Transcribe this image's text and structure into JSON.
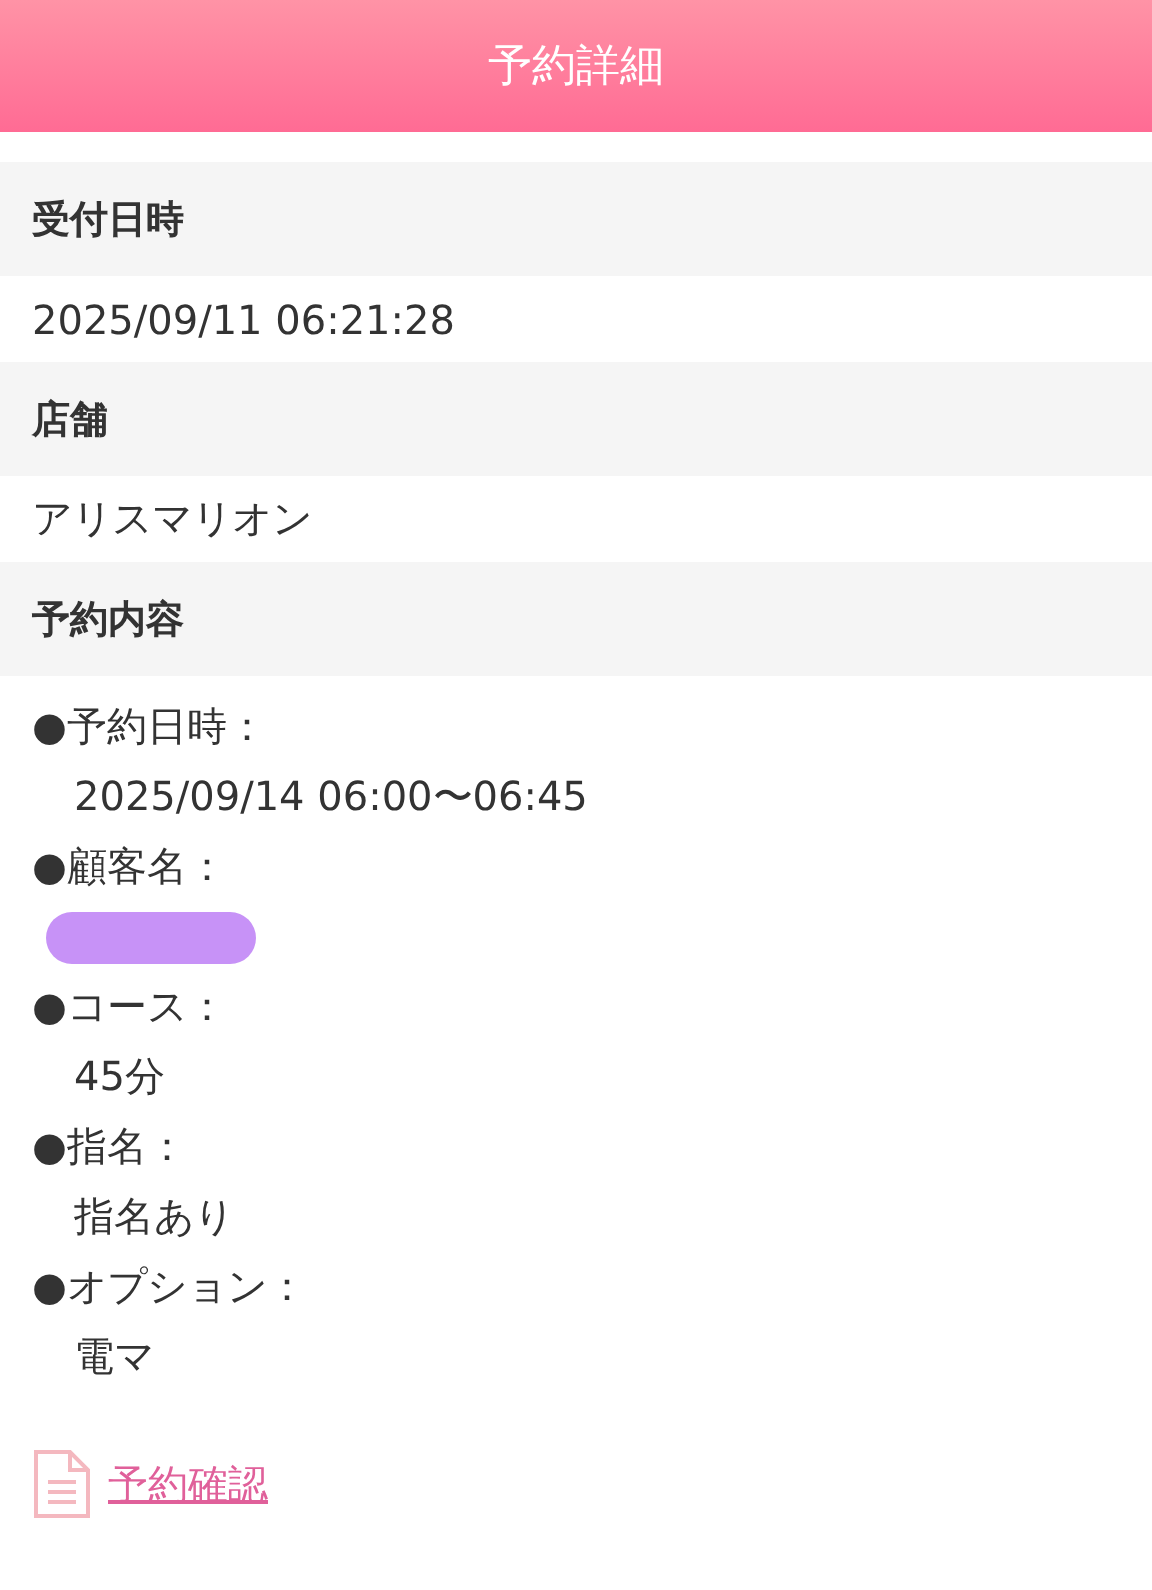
{
  "header": {
    "title": "予約詳細"
  },
  "sections": [
    {
      "heading": "受付日時",
      "value": "2025/09/11 06:21:28"
    },
    {
      "heading": "店舗",
      "value": "アリスマリオン"
    },
    {
      "heading": "予約内容",
      "items": [
        {
          "label": "●予約日時：",
          "kind": "text",
          "value": "2025/09/14 06:00〜06:45"
        },
        {
          "label": "●顧客名：",
          "kind": "redacted"
        },
        {
          "label": "●コース：",
          "kind": "text",
          "value": "45分"
        },
        {
          "label": "●指名：",
          "kind": "text",
          "value": "指名あり"
        },
        {
          "label": "●オプション：",
          "kind": "text",
          "value": "電マ"
        }
      ]
    }
  ],
  "link": {
    "label": "予約確認"
  }
}
